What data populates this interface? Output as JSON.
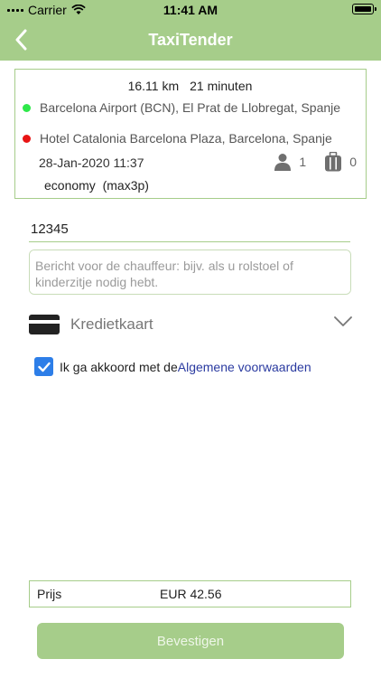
{
  "status_bar": {
    "carrier": "Carrier",
    "time": "11:41 AM"
  },
  "nav": {
    "title": "TaxiTender",
    "back_icon": "chevron-left-icon"
  },
  "trip": {
    "distance": "16.11 km",
    "duration": "21 minuten",
    "pickup": "Barcelona Airport (BCN), El Prat de Llobregat, Spanje",
    "pickup_color": "#2ee84a",
    "dropoff": "Hotel Catalonia Barcelona Plaza, Barcelona, Spanje",
    "dropoff_color": "#e81414",
    "datetime": "28-Jan-2020 11:37",
    "passengers": "1",
    "luggage": "0",
    "car_class": "economy  (max3p)"
  },
  "form": {
    "code_value": "12345",
    "message_placeholder": "Bericht voor de chauffeur: bijv. als u rolstoel of kinderzitje nodig hebt.",
    "payment_method": "Kredietkaart",
    "terms_text": "Ik ga akkoord met de",
    "terms_link": "Algemene voorwaarden",
    "terms_checked": true
  },
  "price": {
    "label": "Prijs",
    "value": "EUR 42.56"
  },
  "confirm_label": "Bevestigen",
  "colors": {
    "accent": "#a6cd8a",
    "checkbox": "#2d7ee8",
    "link": "#2a3aa0"
  }
}
